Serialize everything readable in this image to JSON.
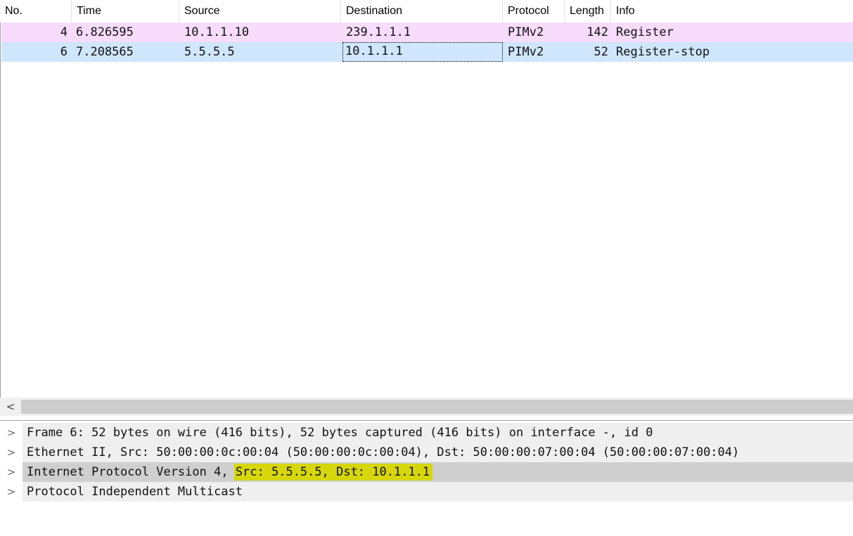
{
  "packet_list": {
    "columns": [
      "No.",
      "Time",
      "Source",
      "Destination",
      "Protocol",
      "Length",
      "Info"
    ],
    "rows": [
      {
        "no": "4",
        "time": "6.826595",
        "source": "10.1.1.10",
        "destination": "239.1.1.1",
        "protocol": "PIMv2",
        "length": "142",
        "info": "Register",
        "row_color": "#f8dcfc"
      },
      {
        "no": "6",
        "time": "7.208565",
        "source": "5.5.5.5",
        "destination": "10.1.1.1",
        "protocol": "PIMv2",
        "length": "52",
        "info": "Register-stop",
        "row_color": "#cfe6fc",
        "selected": true
      }
    ]
  },
  "scrollbar": {
    "left_icon": "chevron-left-icon",
    "left_glyph": "<"
  },
  "details": {
    "expander_icon": "chevron-right-icon",
    "expander_glyph": ">",
    "items": [
      {
        "text": "Frame 6: 52 bytes on wire (416 bits), 52 bytes captured (416 bits) on interface -, id 0"
      },
      {
        "text": "Ethernet II, Src: 50:00:00:0c:00:04 (50:00:00:0c:00:04), Dst: 50:00:00:07:00:04 (50:00:00:07:00:04)"
      },
      {
        "text_prefix": "Internet Protocol Version 4, ",
        "text_highlight": "Src: 5.5.5.5, Dst: 10.1.1.1",
        "selected": true,
        "highlight_color": "#d6d60a"
      },
      {
        "text": "Protocol Independent Multicast"
      }
    ]
  }
}
